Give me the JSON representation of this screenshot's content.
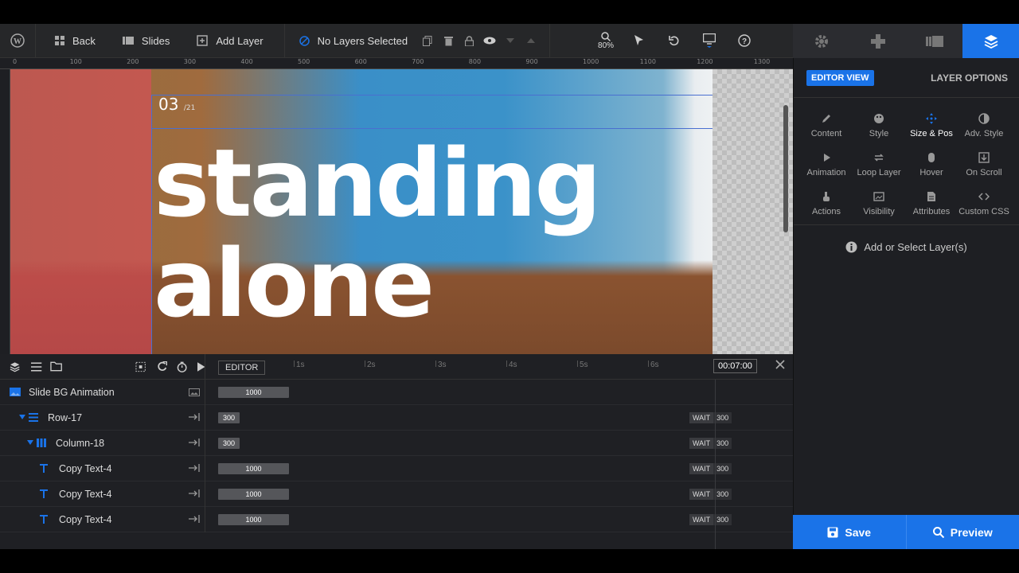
{
  "toolbar": {
    "back": "Back",
    "slides": "Slides",
    "add_layer": "Add Layer",
    "selection": "No Layers Selected",
    "zoom": "80%"
  },
  "ruler": [
    "0",
    "100",
    "200",
    "300",
    "400",
    "500",
    "600",
    "700",
    "800",
    "900",
    "1000",
    "1100",
    "1200",
    "1300"
  ],
  "canvas": {
    "slide_number": "03",
    "slide_total": "/21",
    "headline_line1": "standing",
    "headline_line2": "alone"
  },
  "panel": {
    "editor_view": "EDITOR VIEW",
    "layer_options": "LAYER OPTIONS",
    "options": [
      {
        "label": "Content",
        "icon": "pencil-icon"
      },
      {
        "label": "Style",
        "icon": "palette-icon"
      },
      {
        "label": "Size & Pos",
        "icon": "move-icon"
      },
      {
        "label": "Adv. Style",
        "icon": "contrast-icon"
      },
      {
        "label": "Animation",
        "icon": "play-icon"
      },
      {
        "label": "Loop Layer",
        "icon": "loop-icon"
      },
      {
        "label": "Hover",
        "icon": "mouse-icon"
      },
      {
        "label": "On Scroll",
        "icon": "scroll-icon"
      },
      {
        "label": "Actions",
        "icon": "pointer-hand-icon"
      },
      {
        "label": "Visibility",
        "icon": "visibility-icon"
      },
      {
        "label": "Attributes",
        "icon": "document-icon"
      },
      {
        "label": "Custom CSS",
        "icon": "code-icon"
      }
    ],
    "active_option": "Size & Pos",
    "hint": "Add or Select Layer(s)",
    "save": "Save",
    "preview": "Preview"
  },
  "timeline": {
    "editor_tag": "EDITOR",
    "seconds": [
      "1s",
      "2s",
      "3s",
      "4s",
      "5s",
      "6s"
    ],
    "duration": "00:07:00",
    "rows": [
      {
        "name": "Slide BG Animation",
        "bar": "1000",
        "wait": "",
        "wait_val": ""
      },
      {
        "name": "Row-17",
        "bar": "300",
        "wait": "WAIT",
        "wait_val": "300"
      },
      {
        "name": "Column-18",
        "bar": "300",
        "wait": "WAIT",
        "wait_val": "300"
      },
      {
        "name": "Copy Text-4",
        "bar": "1000",
        "wait": "WAIT",
        "wait_val": "300"
      },
      {
        "name": "Copy Text-4",
        "bar": "1000",
        "wait": "WAIT",
        "wait_val": "300"
      },
      {
        "name": "Copy Text-4",
        "bar": "1000",
        "wait": "WAIT",
        "wait_val": "300"
      }
    ]
  },
  "colors": {
    "accent": "#1a73e8",
    "panel": "#1e1f23",
    "overlay": "#e5475e"
  }
}
